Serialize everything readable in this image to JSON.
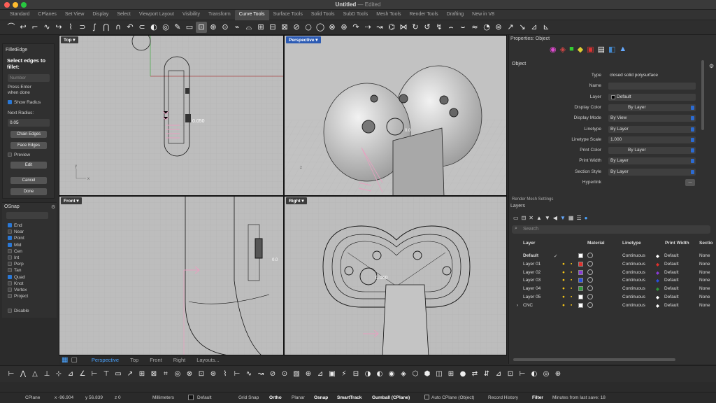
{
  "window": {
    "title": "Untitled",
    "edited": "— Edited"
  },
  "tabs": [
    "Standard",
    "CPlanes",
    "Set View",
    "Display",
    "Select",
    "Viewport Layout",
    "Visibility",
    "Transform",
    "Curve Tools",
    "Surface Tools",
    "Solid Tools",
    "SubD Tools",
    "Mesh Tools",
    "Render Tools",
    "Drafting",
    "New in V8"
  ],
  "active_tab": "Curve Tools",
  "fillet": {
    "title": "FilletEdge",
    "prompt": "Select edges to fillet:",
    "number_placeholder": "Number",
    "hint1": "Press Enter",
    "hint2": "when done",
    "show_radius": "Show Radius",
    "next_radius_label": "Next Radius:",
    "next_radius": "0.05",
    "chain": "Chain Edges",
    "face": "Face Edges",
    "preview": "Preview",
    "edit": "Edit",
    "cancel": "Cancel",
    "done": "Done"
  },
  "osnap": {
    "title": "OSnap",
    "items": [
      {
        "label": "End",
        "on": true
      },
      {
        "label": "Near",
        "on": false
      },
      {
        "label": "Point",
        "on": true
      },
      {
        "label": "Mid",
        "on": true
      },
      {
        "label": "Cen",
        "on": false
      },
      {
        "label": "Int",
        "on": false
      },
      {
        "label": "Perp",
        "on": false
      },
      {
        "label": "Tan",
        "on": false
      },
      {
        "label": "Quad",
        "on": true
      },
      {
        "label": "Knot",
        "on": false
      },
      {
        "label": "Vertex",
        "on": false
      },
      {
        "label": "Project",
        "on": false
      }
    ],
    "disable": "Disable"
  },
  "viewports": {
    "top": "Top",
    "perspective": "Perspective",
    "front": "Front",
    "right": "Right",
    "radius_label": "0.050",
    "radius_label_short": "0.0"
  },
  "viewport_tabs": [
    "Perspective",
    "Top",
    "Front",
    "Right",
    "Layouts..."
  ],
  "active_viewport_tab": "Perspective",
  "properties": {
    "header": "Properties: Object",
    "section": "Object",
    "rows": [
      {
        "label": "Type",
        "value": "closed solid polysurface"
      },
      {
        "label": "Name",
        "value": ""
      },
      {
        "label": "Layer",
        "value": "Default"
      },
      {
        "label": "Display Color",
        "value": "By Layer"
      },
      {
        "label": "Display Mode",
        "value": "By View"
      },
      {
        "label": "Linetype",
        "value": "By Layer"
      },
      {
        "label": "Linetype Scale",
        "value": "1.000"
      },
      {
        "label": "Print Color",
        "value": "By Layer"
      },
      {
        "label": "Print Width",
        "value": "By Layer"
      },
      {
        "label": "Section Style",
        "value": "By Layer"
      },
      {
        "label": "Hyperlink",
        "value": ""
      }
    ],
    "more": "...",
    "cut": "Render Mesh Settings"
  },
  "layers": {
    "title": "Layers",
    "search_placeholder": "Search",
    "columns": [
      "Layer",
      "Material",
      "Linetype",
      "Print Width",
      "Sectio"
    ],
    "rows": [
      {
        "name": "Default",
        "color": "#ffffff",
        "linetype": "Continuous",
        "width": "Default",
        "section": "None",
        "current": true
      },
      {
        "name": "Layer 01",
        "color": "#e0302b",
        "linetype": "Continuous",
        "width": "Default",
        "section": "None"
      },
      {
        "name": "Layer 02",
        "color": "#8a3ad6",
        "linetype": "Continuous",
        "width": "Default",
        "section": "None"
      },
      {
        "name": "Layer 03",
        "color": "#2a4fe0",
        "linetype": "Continuous",
        "width": "Default",
        "section": "None"
      },
      {
        "name": "Layer 04",
        "color": "#2f9a3a",
        "linetype": "Continuous",
        "width": "Default",
        "section": "None"
      },
      {
        "name": "Layer 05",
        "color": "#ffffff",
        "linetype": "Continuous",
        "width": "Default",
        "section": "None"
      },
      {
        "name": "CNC",
        "color": "#ffffff",
        "linetype": "Continuous",
        "width": "Default",
        "section": "None"
      }
    ]
  },
  "status": {
    "cplane": "CPlane",
    "x": "x -96.904",
    "y": "y 56.839",
    "z": "z 0",
    "units": "Millimeters",
    "layer": "Default",
    "grid_snap": "Grid Snap",
    "ortho": "Ortho",
    "planar": "Planar",
    "osnap": "Osnap",
    "smarttrack": "SmartTrack",
    "gumball": "Gumball (CPlane)",
    "auto_cplane": "Auto CPlane (Object)",
    "record": "Record History",
    "filter": "Filter",
    "save": "Minutes from last save: 18"
  }
}
